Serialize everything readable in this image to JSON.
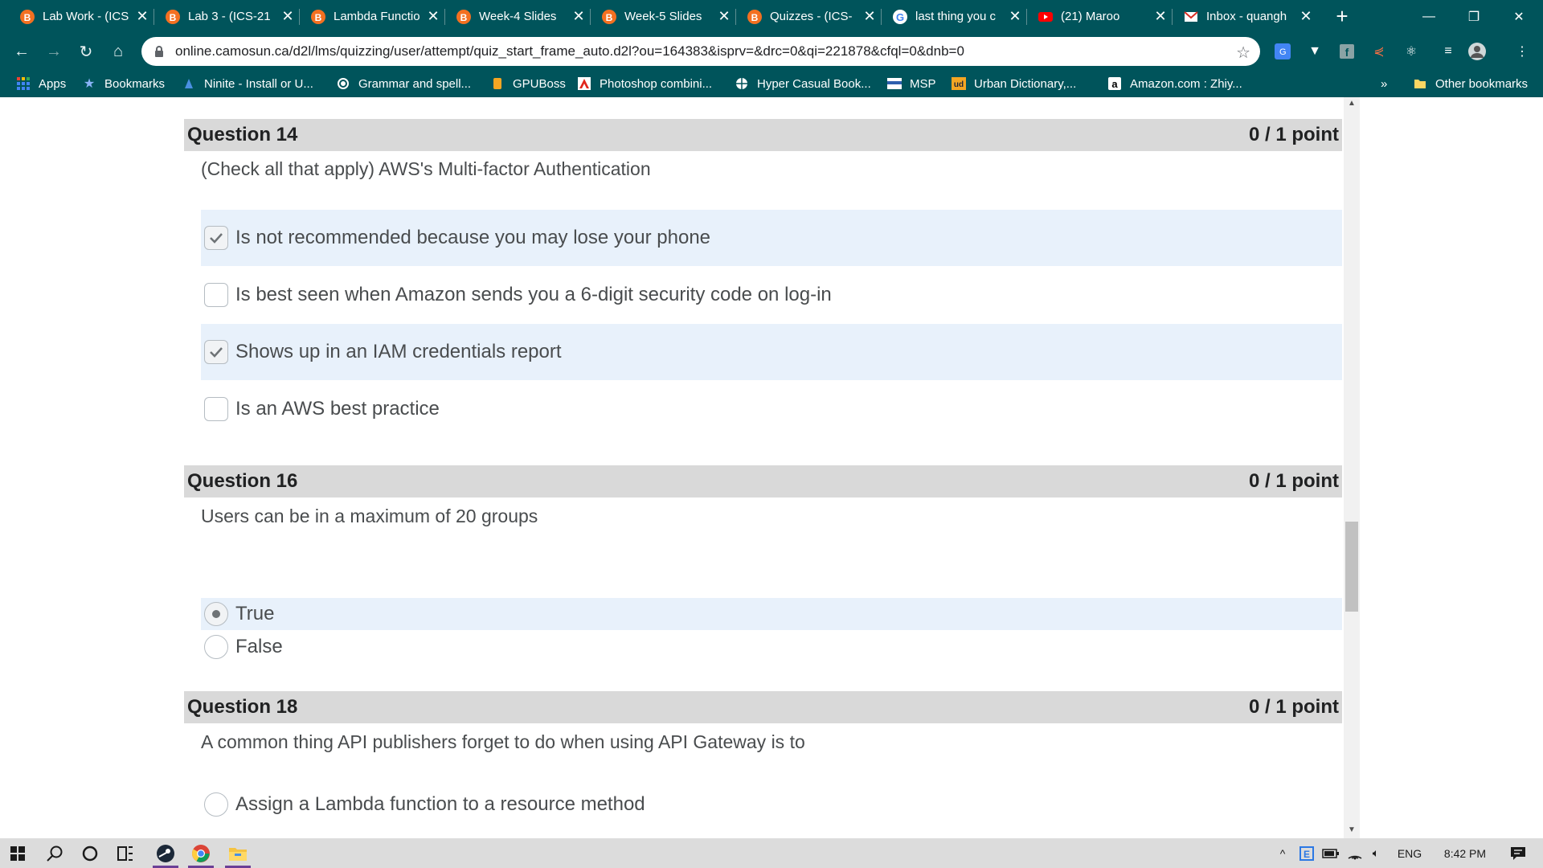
{
  "browser": {
    "tabs": [
      {
        "title": "Lab Work - (ICS",
        "icon": "brightspace-icon"
      },
      {
        "title": "Lab 3 - (ICS-21",
        "icon": "brightspace-icon"
      },
      {
        "title": "Lambda Functio",
        "icon": "brightspace-icon"
      },
      {
        "title": "Week-4 Slides",
        "icon": "brightspace-icon"
      },
      {
        "title": "Week-5 Slides",
        "icon": "brightspace-icon"
      },
      {
        "title": "Quizzes - (ICS-",
        "icon": "brightspace-icon",
        "active": true
      },
      {
        "title": "last thing you c",
        "icon": "google-icon"
      },
      {
        "title": "(21) Maroo",
        "icon": "youtube-icon"
      },
      {
        "title": "Inbox - quangh",
        "icon": "gmail-icon"
      }
    ],
    "address": "online.camosun.ca/d2l/lms/quizzing/user/attempt/quiz_start_frame_auto.d2l?ou=164383&isprv=&drc=0&qi=221878&cfql=0&dnb=0",
    "bookmarks": [
      {
        "label": "Apps",
        "icon": "apps-grid-icon"
      },
      {
        "label": "Bookmarks",
        "icon": "star-icon"
      },
      {
        "label": "Ninite - Install or U...",
        "icon": "ninite-icon"
      },
      {
        "label": "Grammar and spell...",
        "icon": "grammar-icon"
      },
      {
        "label": "GPUBoss",
        "icon": "gpuboss-icon"
      },
      {
        "label": "Photoshop combini...",
        "icon": "adobe-icon"
      },
      {
        "label": "Hyper Casual Book...",
        "icon": "globe-icon"
      },
      {
        "label": "MSP",
        "icon": "msp-icon"
      },
      {
        "label": "Urban Dictionary,...",
        "icon": "urban-dictionary-icon"
      },
      {
        "label": "Amazon.com : Zhiy...",
        "icon": "amazon-icon"
      }
    ],
    "bookmarks_overflow": "»",
    "other_bookmarks": "Other bookmarks"
  },
  "quiz": {
    "q14": {
      "title": "Question 14",
      "points": "0 / 1 point",
      "text": "(Check all that apply) AWS's Multi-factor Authentication",
      "options": [
        {
          "label": "Is not recommended because you may lose your phone",
          "checked": true
        },
        {
          "label": "Is best seen when Amazon sends you a 6-digit security code on log-in",
          "checked": false
        },
        {
          "label": "Shows up in an IAM credentials report",
          "checked": true
        },
        {
          "label": "Is an AWS best practice",
          "checked": false
        }
      ]
    },
    "q16": {
      "title": "Question 16",
      "points": "0 / 1 point",
      "text": "Users can be in a maximum of 20 groups",
      "options": [
        {
          "label": "True",
          "checked": true
        },
        {
          "label": "False",
          "checked": false
        }
      ]
    },
    "q18": {
      "title": "Question 18",
      "points": "0 / 1 point",
      "text": "A common thing API publishers forget to do when using API Gateway is to",
      "options": [
        {
          "label": "Assign a Lambda function to a resource method",
          "checked": false
        }
      ]
    }
  },
  "taskbar": {
    "language": "ENG",
    "time": "8:42 PM"
  },
  "colors": {
    "chrome_frame": "#00545b",
    "question_header": "#d9d9d9",
    "selected_option": "#e8f1fb",
    "taskbar": "#dcdcdc"
  }
}
